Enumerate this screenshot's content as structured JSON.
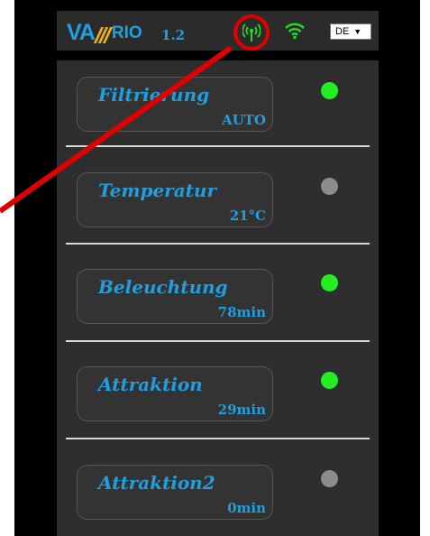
{
  "header": {
    "logo": {
      "va": "VA",
      "rio": "RIO"
    },
    "version": "1.2",
    "language": {
      "selected": "DE",
      "caret": "▼"
    },
    "icons": {
      "antenna": "antenna-icon",
      "wifi": "wifi-icon"
    }
  },
  "items": [
    {
      "label": "Filtrierung",
      "value": "AUTO",
      "status_color": "#22ee22"
    },
    {
      "label": "Temperatur",
      "value": "21°C",
      "status_color": "#8c8c8c"
    },
    {
      "label": "Beleuchtung",
      "value": "78min",
      "status_color": "#22ee22"
    },
    {
      "label": "Attraktion",
      "value": "29min",
      "status_color": "#22ee22"
    },
    {
      "label": "Attraktion2",
      "value": "0min",
      "status_color": "#8c8c8c"
    }
  ],
  "colors": {
    "accent_blue": "#1f9fe0",
    "annotation_red": "#e10000",
    "status_on": "#22ee22",
    "status_off": "#8c8c8c"
  }
}
